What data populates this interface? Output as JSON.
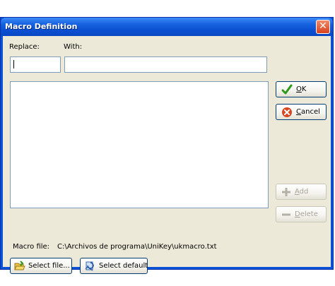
{
  "window": {
    "title": "Macro Definition",
    "close_label": "✕"
  },
  "labels": {
    "replace": "Replace:",
    "with": "With:"
  },
  "fields": {
    "replace_value": "",
    "with_value": ""
  },
  "buttons": {
    "ok": {
      "mnemonic": "O",
      "rest": "K"
    },
    "cancel": {
      "mnemonic": "C",
      "rest": "ancel"
    },
    "add": {
      "mnemonic": "A",
      "rest": "dd"
    },
    "delete": {
      "mnemonic": "D",
      "rest": "elete"
    },
    "select_file": "Select file...",
    "select_default": "Select default"
  },
  "macro_file": {
    "label": "Macro file:",
    "path": "C:\\Archivos de programa\\UniKey\\ukmacro.txt"
  },
  "icons": {
    "ok": "checkmark-icon",
    "cancel": "cancel-icon",
    "add": "plus-icon",
    "delete": "minus-icon",
    "select_file": "folder-open-icon",
    "select_default": "restore-icon"
  }
}
